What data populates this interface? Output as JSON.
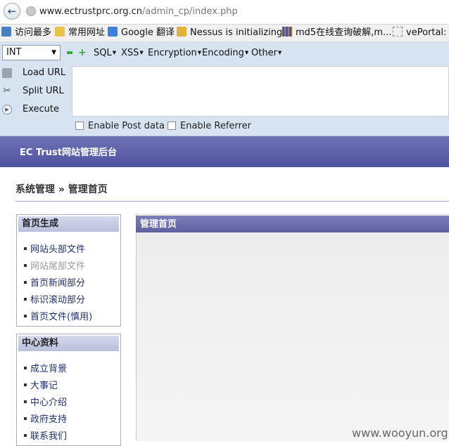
{
  "browser": {
    "url_host": "www.ectrustprc.org.cn",
    "url_path": "/admin_cp/index.php",
    "back_icon": "back-arrow-icon"
  },
  "bookmarks": [
    {
      "label": "访问最多"
    },
    {
      "label": "常用网址"
    },
    {
      "label": "Google 翻译"
    },
    {
      "label": "Nessus is initializing..."
    },
    {
      "label": "md5在线查询破解,m..."
    },
    {
      "label": "vePortal: T"
    }
  ],
  "hackbar": {
    "select_value": "INT",
    "menus": [
      "SQL",
      "XSS",
      "Encryption",
      "Encoding",
      "Other"
    ],
    "load_url": "Load URL",
    "split_url": "Split URL",
    "execute": "Execute",
    "enable_post": "Enable Post data",
    "enable_referrer": "Enable Referrer",
    "accent": "#d7e3f0"
  },
  "page": {
    "title": "EC Trust网站管理后台",
    "breadcrumb": "系统管理 » 管理首页",
    "header_color": "#5a5ea5"
  },
  "sidebar": {
    "groups": [
      {
        "title": "首页生成",
        "items": [
          "网站头部文件",
          "网站尾部文件",
          "首页新闻部分",
          "标识滚动部分",
          "首页文件(慎用)"
        ]
      },
      {
        "title": "中心资料",
        "items": [
          "成立背景",
          "大事记",
          "中心介绍",
          "政府支持",
          "联系我们"
        ]
      }
    ]
  },
  "main": {
    "panel_title": "管理首页"
  },
  "watermark": "www.wooyun.org"
}
